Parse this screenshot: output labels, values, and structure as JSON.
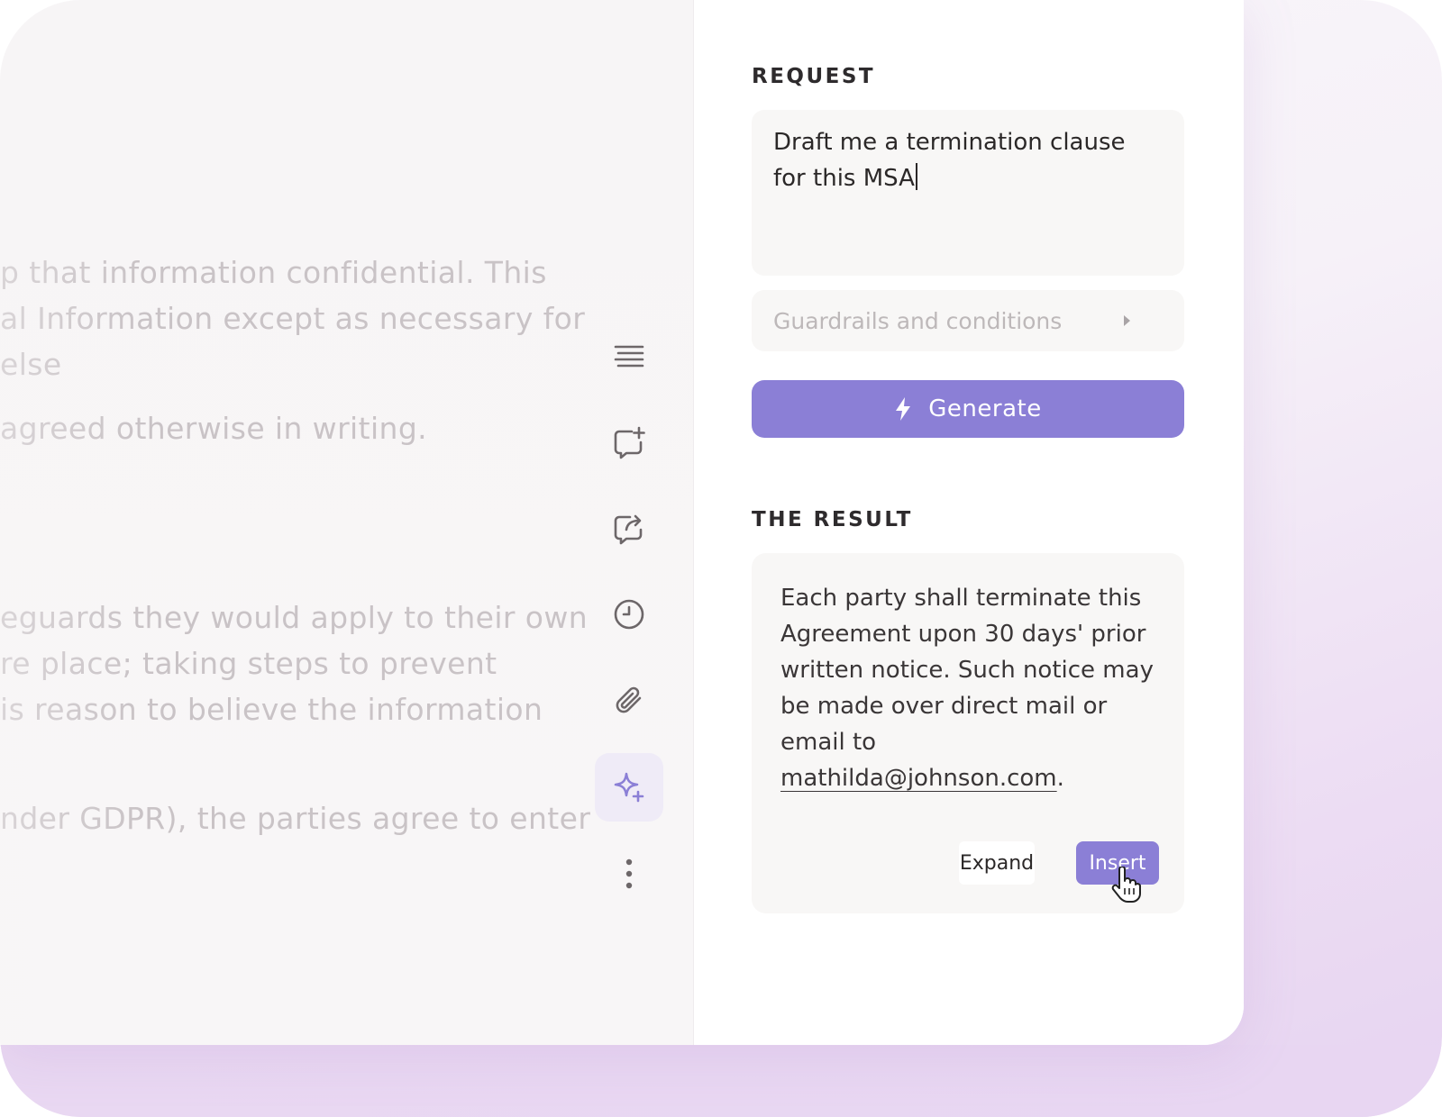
{
  "document": {
    "lines": [
      "p that information confidential. This",
      "al Information except as necessary for",
      "else",
      "agreed otherwise in writing.",
      "eguards they would apply to their own",
      "re place; taking steps to prevent",
      "is reason to believe the information",
      "nder GDPR), the parties agree to enter"
    ]
  },
  "toolbar": {
    "items": [
      {
        "icon": "align-text-icon"
      },
      {
        "icon": "add-comment-icon"
      },
      {
        "icon": "share-comment-icon"
      },
      {
        "icon": "history-clock-icon"
      },
      {
        "icon": "paperclip-icon"
      },
      {
        "icon": "sparkle-ai-icon",
        "active": true
      },
      {
        "icon": "more-vertical-icon"
      }
    ]
  },
  "panel": {
    "request_label": "REQUEST",
    "request_text": "Draft me a termination clause for this MSA",
    "guardrails_label": "Guardrails and conditions",
    "generate_label": "Generate",
    "result_label": "THE RESULT",
    "result_text": "Each party shall terminate this Agreement upon 30 days' prior written notice. Such notice may be made over direct mail or email to",
    "result_link": "mathilda@johnson.com",
    "result_suffix": ".",
    "expand_label": "Expand",
    "insert_label": "Insert"
  },
  "colors": {
    "accent": "#8b7fd6",
    "active_tool_bg": "#efebf7",
    "background_glow": "#e8d6f2"
  }
}
